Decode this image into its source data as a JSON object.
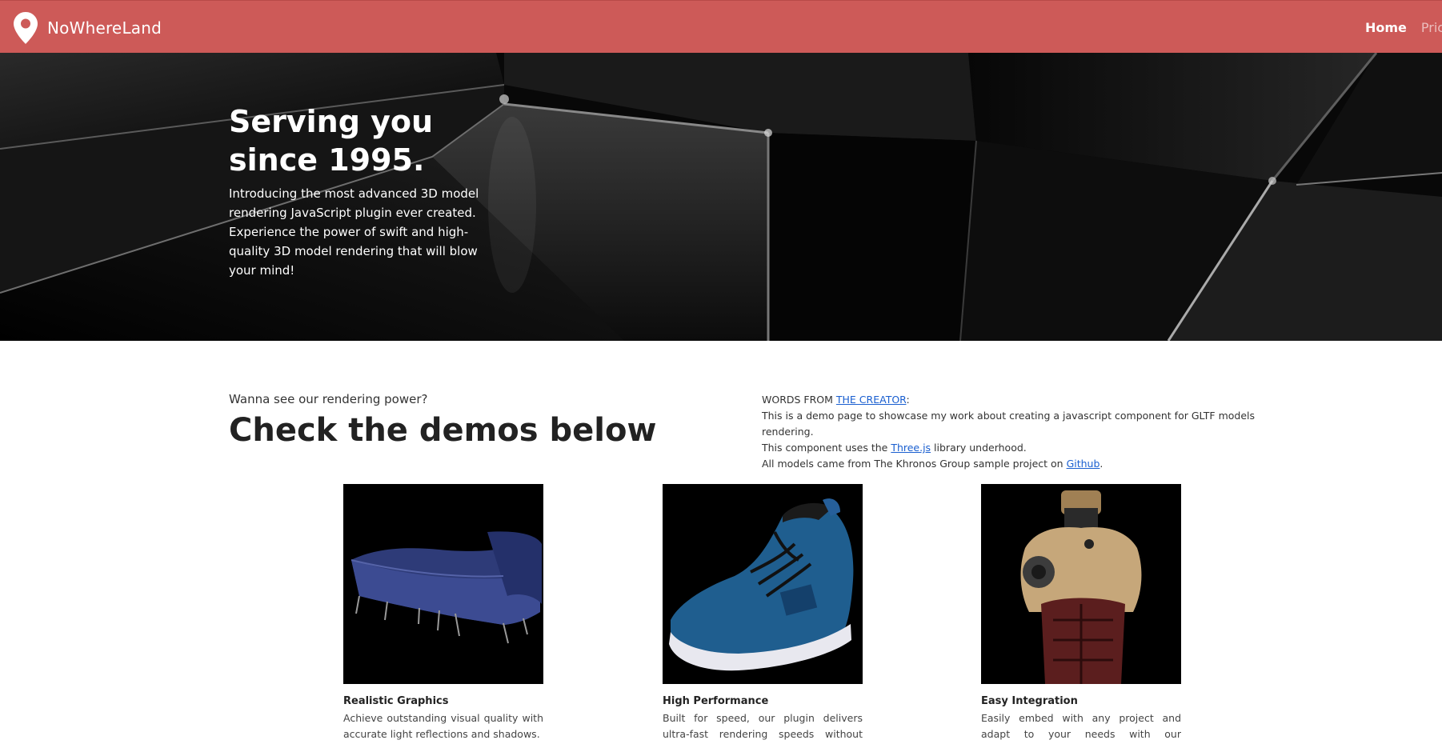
{
  "brand": {
    "name": "NoWhereLand",
    "logo_icon": "map-pin-icon"
  },
  "nav": {
    "items": [
      "Home",
      "Pricin"
    ]
  },
  "hero": {
    "title_line1": "Serving you",
    "title_line2": "since 1995.",
    "description": "Introducing the most advanced 3D model rendering JavaScript plugin ever created. Experience the power of swift and high-quality 3D model rendering that will blow your mind!"
  },
  "demos": {
    "eyebrow": "Wanna see our rendering power?",
    "title": "Check the demos below"
  },
  "words": {
    "prefix": "WORDS FROM ",
    "creator_link": "THE CREATOR",
    "suffix": ":",
    "line1": "This is a demo page to showcase my work about creating a javascript component for GLTF models rendering.",
    "line2_prefix": "This component uses the ",
    "line2_link": "Three.js",
    "line2_suffix": " library underhood.",
    "line3_prefix": "All models came from The Khronos Group sample project on ",
    "line3_link": "Github",
    "line3_suffix": "."
  },
  "cards": [
    {
      "title": "Realistic Graphics",
      "description": "Achieve outstanding visual quality with accurate light reflections and shadows.",
      "image": "sofa-model"
    },
    {
      "title": "High Performance",
      "description": "Built for speed, our plugin delivers ultra-fast rendering speeds without sacrificing",
      "image": "sneaker-model"
    },
    {
      "title": "Easy Integration",
      "description": "Easily embed with any project and adapt to your needs with our comprehensive",
      "image": "mannequin-model"
    }
  ],
  "colors": {
    "navbar": "#cd5a58",
    "link": "#1a5fd0"
  }
}
